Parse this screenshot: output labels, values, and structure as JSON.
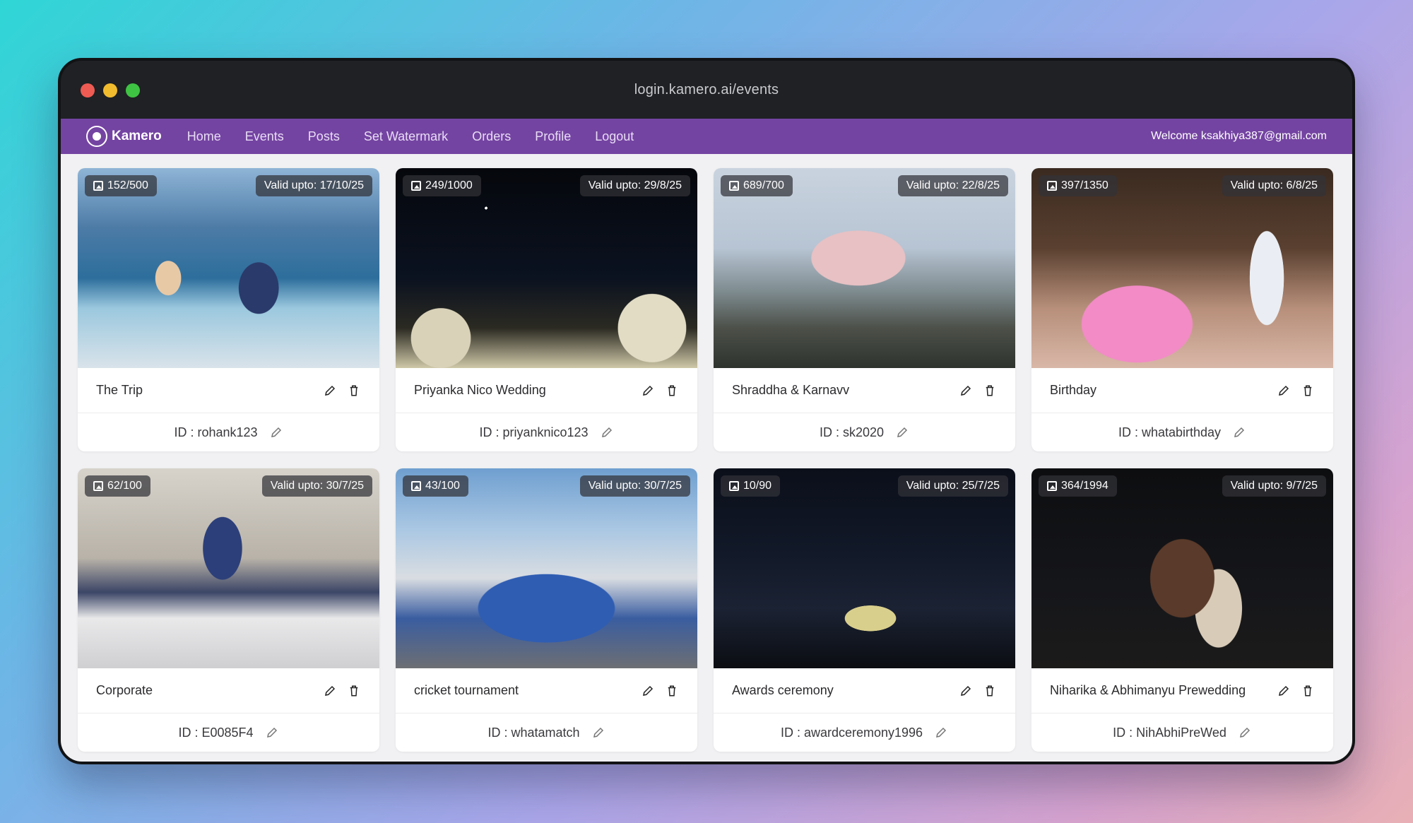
{
  "window": {
    "url": "login.kamero.ai/events"
  },
  "nav": {
    "brand": "Kamero",
    "links": [
      "Home",
      "Events",
      "Posts",
      "Set Watermark",
      "Orders",
      "Profile",
      "Logout"
    ],
    "welcome": "Welcome ksakhiya387@gmail.com"
  },
  "events": [
    {
      "title": "The Trip",
      "count": "152/500",
      "valid": "Valid upto: 17/10/25",
      "id": "ID : rohank123"
    },
    {
      "title": "Priyanka Nico Wedding",
      "count": "249/1000",
      "valid": "Valid upto: 29/8/25",
      "id": "ID : priyanknico123"
    },
    {
      "title": "Shraddha & Karnavv",
      "count": "689/700",
      "valid": "Valid upto: 22/8/25",
      "id": "ID : sk2020"
    },
    {
      "title": "Birthday",
      "count": "397/1350",
      "valid": "Valid upto: 6/8/25",
      "id": "ID : whatabirthday"
    },
    {
      "title": "Corporate",
      "count": "62/100",
      "valid": "Valid upto: 30/7/25",
      "id": "ID : E0085F4"
    },
    {
      "title": "cricket tournament",
      "count": "43/100",
      "valid": "Valid upto: 30/7/25",
      "id": "ID : whatamatch"
    },
    {
      "title": "Awards ceremony",
      "count": "10/90",
      "valid": "Valid upto: 25/7/25",
      "id": "ID : awardceremony1996"
    },
    {
      "title": "Niharika & Abhimanyu Prewedding",
      "count": "364/1994",
      "valid": "Valid upto: 9/7/25",
      "id": "ID : NihAbhiPreWed"
    }
  ]
}
